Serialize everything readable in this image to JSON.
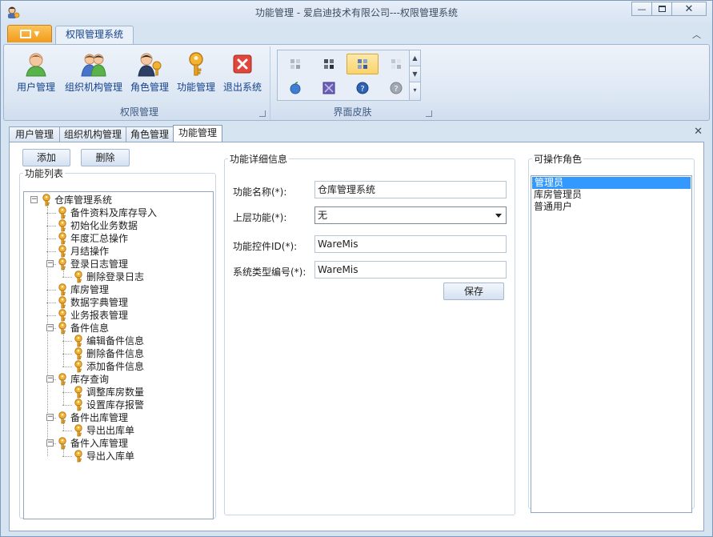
{
  "window": {
    "title": "功能管理 - 爱启迪技术有限公司---权限管理系统",
    "controls": [
      "minimize",
      "maximize",
      "close"
    ]
  },
  "ribbon": {
    "tab": "权限管理系统",
    "groups": [
      {
        "label": "权限管理",
        "buttons": [
          {
            "label": "用户管理",
            "icon": "user-icon"
          },
          {
            "label": "组织机构管理",
            "icon": "organization-icon"
          },
          {
            "label": "角色管理",
            "icon": "role-key-icon"
          },
          {
            "label": "功能管理",
            "icon": "function-key-icon"
          },
          {
            "label": "退出系统",
            "icon": "exit-icon"
          }
        ]
      },
      {
        "label": "界面皮肤",
        "skins": [
          "skin-grid-gray",
          "skin-grid-dark",
          "skin-grid-blue",
          "skin-grid-light",
          "skin-apple",
          "skin-x-purple",
          "skin-help-blue",
          "skin-help-gray"
        ],
        "selected_index": 2
      }
    ]
  },
  "doc_tabs": [
    {
      "label": "用户管理"
    },
    {
      "label": "组织机构管理"
    },
    {
      "label": "角色管理"
    },
    {
      "label": "功能管理",
      "active": true
    }
  ],
  "content": {
    "add_button": "添加",
    "delete_button": "删除",
    "function_list_title": "功能列表",
    "tree": [
      {
        "label": "仓库管理系统",
        "level": 0,
        "expander": "−"
      },
      {
        "label": "备件资料及库存导入",
        "level": 1
      },
      {
        "label": "初始化业务数据",
        "level": 1
      },
      {
        "label": "年度汇总操作",
        "level": 1
      },
      {
        "label": "月结操作",
        "level": 1
      },
      {
        "label": "登录日志管理",
        "level": 1,
        "expander": "−"
      },
      {
        "label": "删除登录日志",
        "level": 2
      },
      {
        "label": "库房管理",
        "level": 1
      },
      {
        "label": "数据字典管理",
        "level": 1
      },
      {
        "label": "业务报表管理",
        "level": 1
      },
      {
        "label": "备件信息",
        "level": 1,
        "expander": "−"
      },
      {
        "label": "编辑备件信息",
        "level": 2
      },
      {
        "label": "删除备件信息",
        "level": 2
      },
      {
        "label": "添加备件信息",
        "level": 2
      },
      {
        "label": "库存查询",
        "level": 1,
        "expander": "−"
      },
      {
        "label": "调整库房数量",
        "level": 2
      },
      {
        "label": "设置库存报警",
        "level": 2
      },
      {
        "label": "备件出库管理",
        "level": 1,
        "expander": "−"
      },
      {
        "label": "导出出库单",
        "level": 2
      },
      {
        "label": "备件入库管理",
        "level": 1,
        "expander": "−"
      },
      {
        "label": "导出入库单",
        "level": 2
      }
    ],
    "detail": {
      "title": "功能详细信息",
      "name_label": "功能名称(*):",
      "name_value": "仓库管理系统",
      "parent_label": "上层功能(*):",
      "parent_value": "无",
      "control_id_label": "功能控件ID(*):",
      "control_id_value": "WareMis",
      "system_type_label": "系统类型编号(*):",
      "system_type_value": "WareMis",
      "save_button": "保存"
    },
    "roles": {
      "title": "可操作角色",
      "items": [
        "管理员",
        "库房管理员",
        "普通用户"
      ],
      "selected_index": 0
    }
  },
  "colors": {
    "accent_orange": "#f29a1a",
    "ribbon_text": "#15428b",
    "selection_blue": "#3399ff",
    "key_gold": "#e5a520"
  }
}
